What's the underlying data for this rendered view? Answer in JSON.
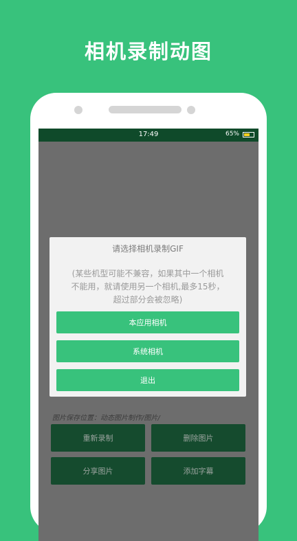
{
  "promo": {
    "title": "相机录制动图"
  },
  "status_bar": {
    "time": "17:49",
    "battery": "65%",
    "battery_level": 0.65,
    "battery_color": "#ffd21f"
  },
  "dialog": {
    "title": "请选择相机录制GIF",
    "note_line1": "(某些机型可能不兼容，如果其中一个相机",
    "note_line2": "不能用，就请使用另一个相机,最多15秒，",
    "note_line3": "超过部分会被忽略)",
    "buttons": {
      "app_camera": "本应用相机",
      "system_camera": "系统相机",
      "exit": "退出"
    }
  },
  "save_path": "图片保存位置：动态图片制作/图片/",
  "actions": {
    "rerecord": "重新录制",
    "delete": "删除图片",
    "share": "分享图片",
    "add_subtitle": "添加字幕"
  },
  "colors": {
    "brand": "#38c27c",
    "status_bar": "#0f4a2a",
    "action_button": "#154b2e"
  }
}
